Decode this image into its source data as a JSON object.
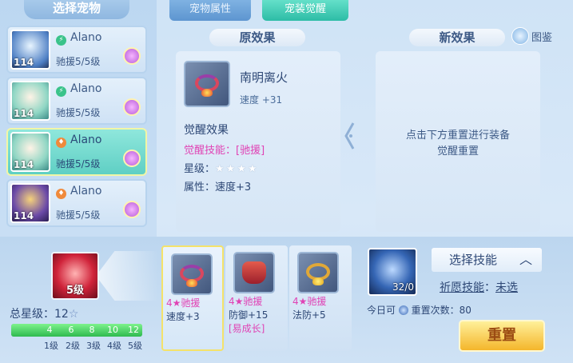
{
  "left_panel": {
    "title": "选择宠物",
    "pets": [
      {
        "name": "Alano",
        "level": "114",
        "sub": "驰援5/5级",
        "type_color": "#3ac38a",
        "type_glyph": "⚡"
      },
      {
        "name": "Alano",
        "level": "114",
        "sub": "驰援5/5级",
        "type_color": "#3ac38a",
        "type_glyph": "⚡"
      },
      {
        "name": "Alano",
        "level": "114",
        "sub": "驰援5/5级",
        "type_color": "#f08a3c",
        "type_glyph": "♦"
      },
      {
        "name": "Alano",
        "level": "114",
        "sub": "驰援5/5级",
        "type_color": "#f08a3c",
        "type_glyph": "♦"
      }
    ]
  },
  "tabs": {
    "attributes": "宠物属性",
    "awaken": "宠装觉醒"
  },
  "original": {
    "header": "原效果",
    "item_name": "南明离火",
    "item_stat": "速度 +31",
    "section_title": "觉醒效果",
    "skill_label": "觉醒技能：",
    "skill_value": "[驰援]",
    "star_label": "星级：",
    "stars": "★★★★",
    "attr_label": "属性：",
    "attr_value": "速度+3"
  },
  "new_effect": {
    "header": "新效果",
    "atlas": "图鉴",
    "hint_line1": "点击下方重置进行装备",
    "hint_line2": "觉醒重置"
  },
  "skill": {
    "level": "5级",
    "total_star_label": "总星级：",
    "total_star_value": "12",
    "total_star_icon": "☆",
    "progress_fraction": 1.0,
    "progress_ticks": [
      "4",
      "6",
      "8",
      "10",
      "12"
    ],
    "level_labels": [
      "1级",
      "2级",
      "3级",
      "4级",
      "5级"
    ]
  },
  "equipment": [
    {
      "title": "4★驰援",
      "stat": "速度+3",
      "extra": ""
    },
    {
      "title": "4★驰援",
      "stat": "防御+15",
      "extra": "[易成长]"
    },
    {
      "title": "4★驰援",
      "stat": "法防+5",
      "extra": ""
    }
  ],
  "reset_area": {
    "orb_count": "32/0",
    "choose_skill": "选择技能",
    "wish_label": "祈愿技能",
    "wish_sep": "：",
    "wish_value": "未选",
    "today_label": "今日可",
    "today_count": "重置次数：80",
    "reset_button": "重置"
  },
  "colors": {
    "accent_teal": "#2dbca6",
    "pink_text": "#e043b5",
    "gold_button": "#f4b62b"
  }
}
